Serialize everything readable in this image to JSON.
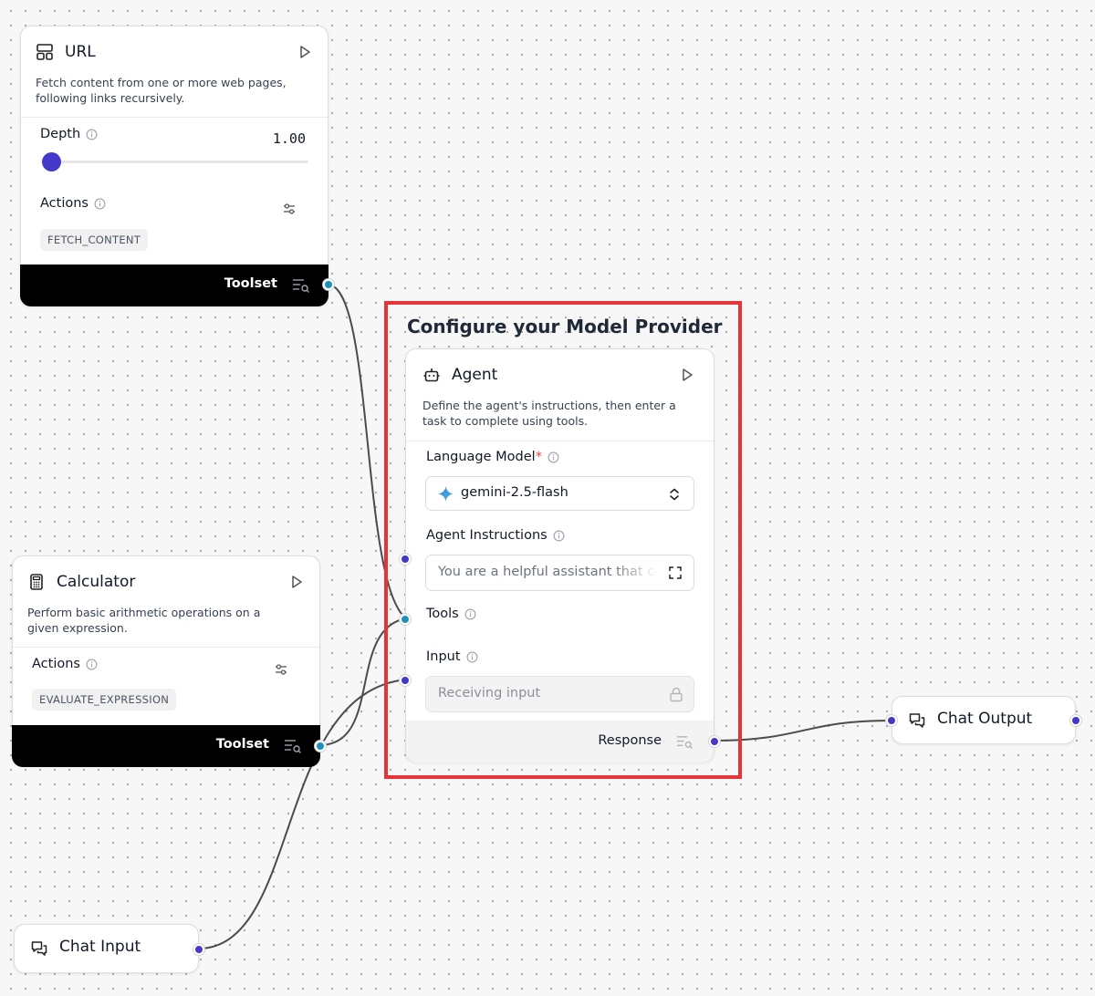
{
  "colors": {
    "highlight": "#e5343a",
    "toolset_bar": "#000000",
    "handle_tool": "#1f91b9",
    "handle_data": "#4338ca",
    "slider_thumb": "#4338ca",
    "required_marker": "#ef4444"
  },
  "highlight": {
    "title": "Configure your Model Provider"
  },
  "url_node": {
    "title": "URL",
    "icon": "layout-icon",
    "description": "Fetch content from one or more web pages, following links recursively.",
    "depth_label": "Depth",
    "depth_value": "1.00",
    "depth_slider_fraction": 0.0,
    "actions_label": "Actions",
    "action_chip": "FETCH_CONTENT",
    "footer_label": "Toolset"
  },
  "calculator_node": {
    "title": "Calculator",
    "icon": "calculator-icon",
    "description": "Perform basic arithmetic operations on a given expression.",
    "actions_label": "Actions",
    "action_chip": "EVALUATE_EXPRESSION",
    "footer_label": "Toolset"
  },
  "agent_node": {
    "title": "Agent",
    "icon": "bot-icon",
    "description": "Define the agent's instructions, then enter a task to complete using tools.",
    "language_model_label": "Language Model",
    "required_marker": "*",
    "language_model_value": "gemini-2.5-flash",
    "instructions_label": "Agent Instructions",
    "instructions_placeholder": "You are a helpful assistant that can use tools to answer questions and perform tasks.",
    "tools_label": "Tools",
    "input_label": "Input",
    "input_placeholder": "Receiving input",
    "footer_label": "Response"
  },
  "chat_input_node": {
    "title": "Chat Input",
    "icon": "messages-icon"
  },
  "chat_output_node": {
    "title": "Chat Output",
    "icon": "messages-icon"
  }
}
